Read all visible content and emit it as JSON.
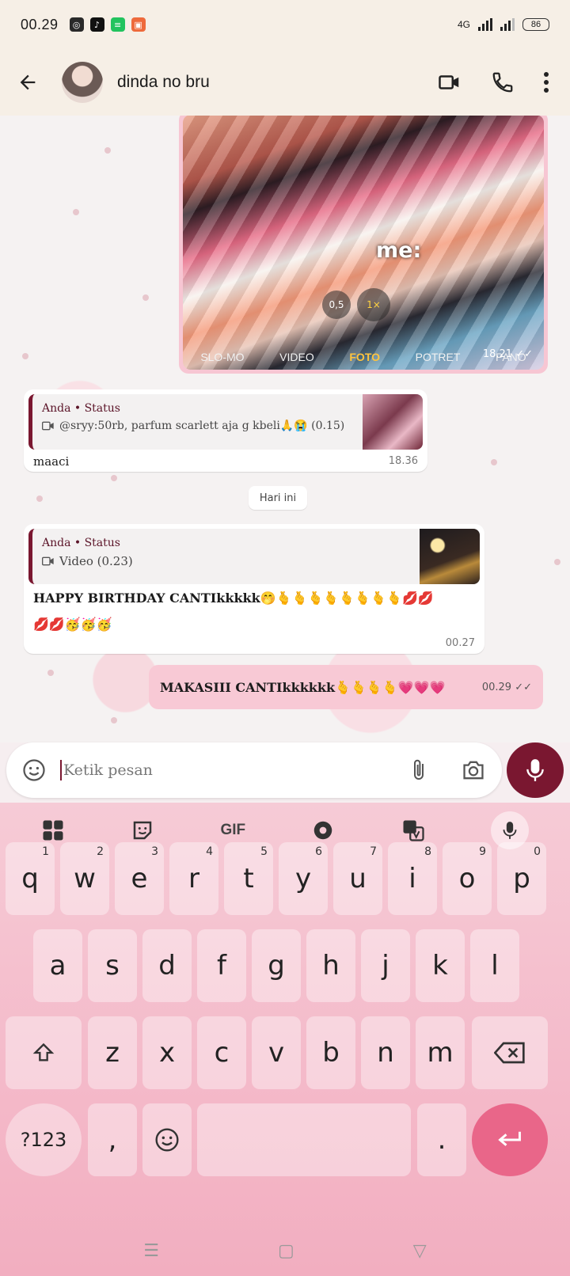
{
  "status_bar": {
    "time": "00.29",
    "network": "4G",
    "battery": "86"
  },
  "header": {
    "contact_name": "dinda no bru"
  },
  "messages": {
    "image": {
      "overlay_text": "me:",
      "zoom_options": [
        "0,5",
        "1×"
      ],
      "camera_modes": [
        "SLO-MO",
        "VIDEO",
        "FOTO",
        "POTRET",
        "PANO"
      ],
      "selected_mode": "FOTO",
      "time": "18.21"
    },
    "reply1": {
      "quote_author": "Anda • Status",
      "quote_text": "@sryy:50rb, parfum scarlett aja g kbeli🙏😭 (0.15)",
      "text": "maaci",
      "time": "18.36"
    },
    "day_separator": "Hari ini",
    "reply2": {
      "quote_author": "Anda • Status",
      "quote_text": "Video (0.23)",
      "text_line1": "HAPPY BIRTHDAY CANTIkkkkk🤭🫰🫰🫰🫰🫰🫰🫰🫰💋💋",
      "text_line2": "💋💋🥳🥳🥳",
      "time": "00.27"
    },
    "outgoing": {
      "text": "MAKASIII CANTIkkkkkk🫰🫰🫰🫰💗💗💗",
      "time": "00.29"
    }
  },
  "input": {
    "placeholder": "Ketik pesan"
  },
  "keyboard": {
    "toolbar_gif": "GIF",
    "row1": [
      "q",
      "w",
      "e",
      "r",
      "t",
      "y",
      "u",
      "i",
      "o",
      "p"
    ],
    "row1_hints": [
      "1",
      "2",
      "3",
      "4",
      "5",
      "6",
      "7",
      "8",
      "9",
      "0"
    ],
    "row2": [
      "a",
      "s",
      "d",
      "f",
      "g",
      "h",
      "j",
      "k",
      "l"
    ],
    "row3": [
      "z",
      "x",
      "c",
      "v",
      "b",
      "n",
      "m"
    ],
    "symbols_key": "?123",
    "comma": ",",
    "period": "."
  },
  "colors": {
    "accent": "#7a1730",
    "keyboard_bg": "#f4b9c9",
    "outgoing_bubble": "#f8c9d5"
  }
}
